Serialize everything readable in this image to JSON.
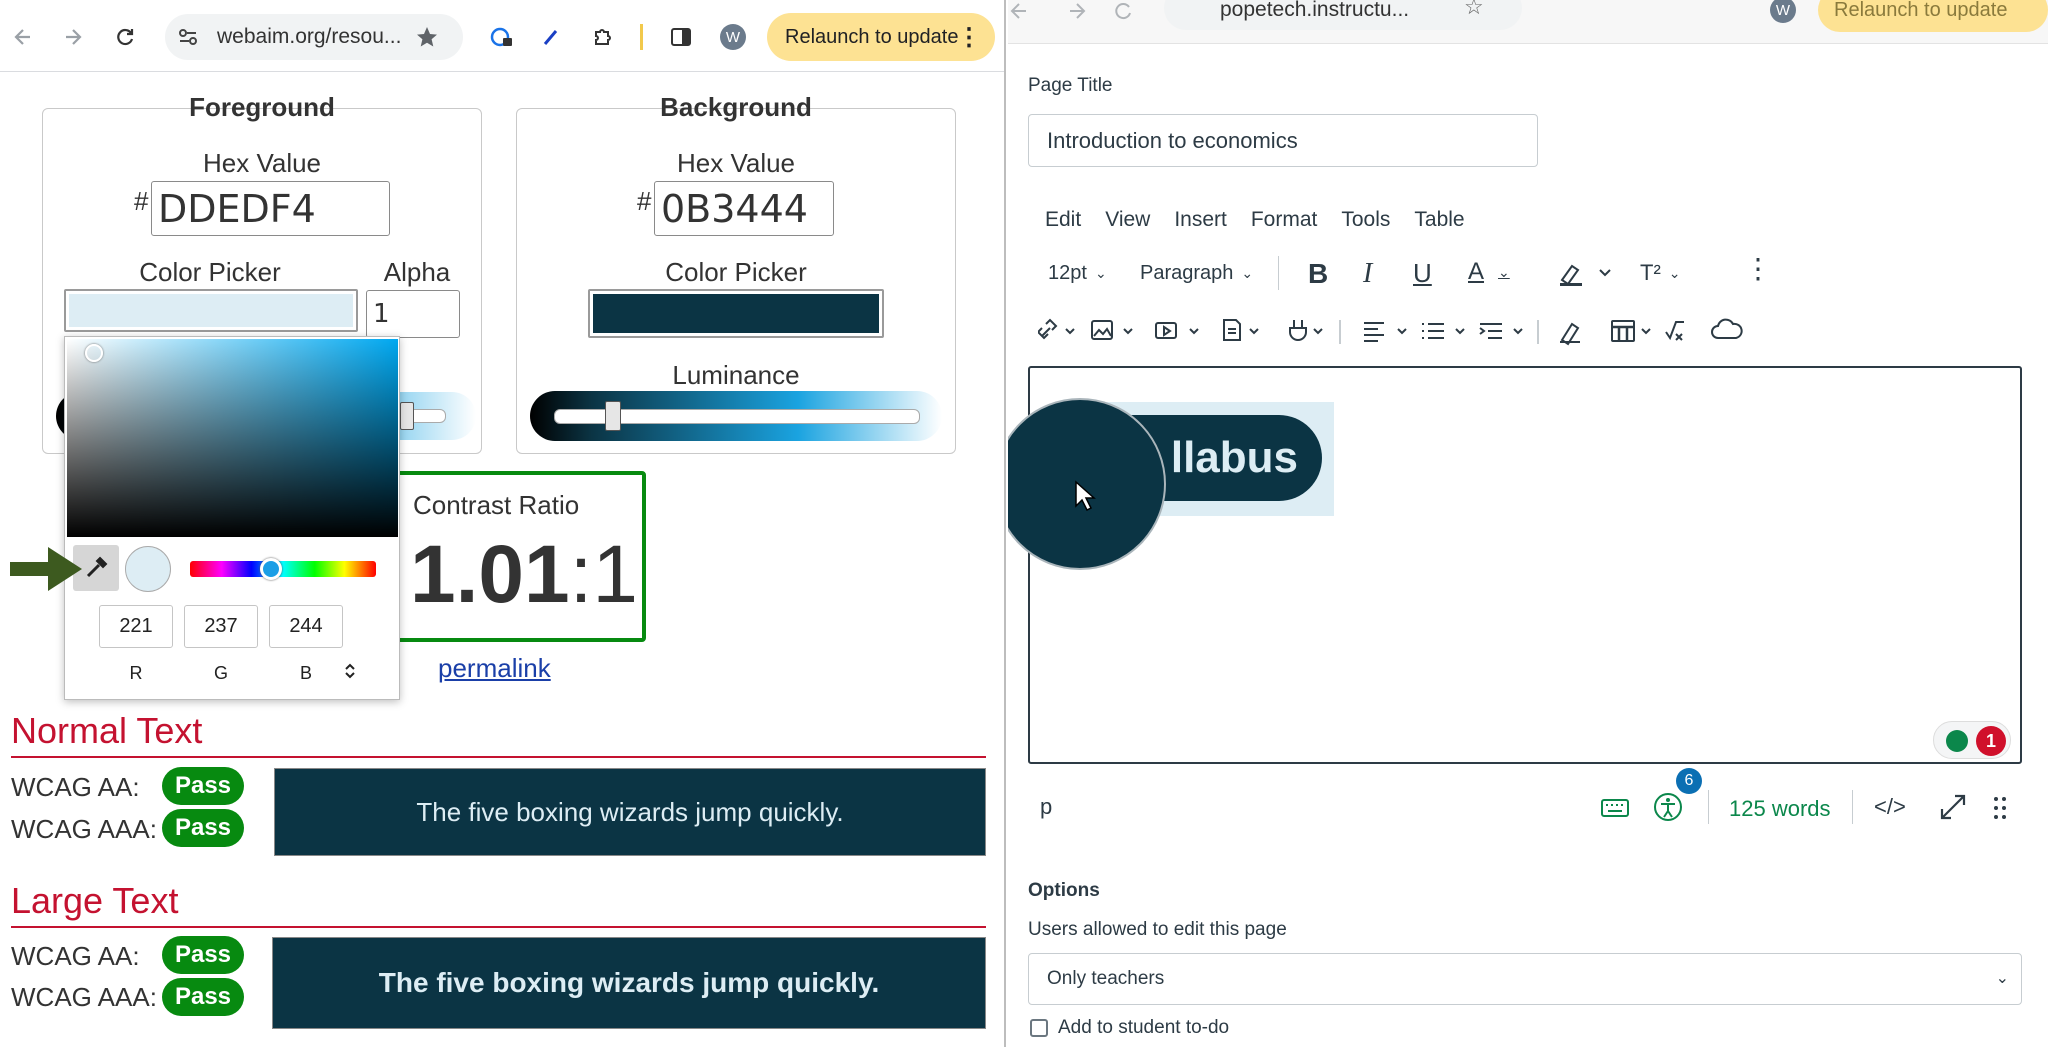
{
  "left_window": {
    "url": "webaim.org/resou...",
    "relaunch_label": "Relaunch to update",
    "avatar_letter": "W",
    "foreground": {
      "title": "Foreground",
      "hex_label": "Hex Value",
      "hash": "#",
      "hex_value": "DDEDF4",
      "picker_label": "Color Picker",
      "alpha_label": "Alpha",
      "alpha_value": "1",
      "color": "#ddedf4"
    },
    "background": {
      "title": "Background",
      "hex_label": "Hex Value",
      "hash": "#",
      "hex_value": "0B3444",
      "picker_label": "Color Picker",
      "luminance_label": "Luminance",
      "color": "#0b3444"
    },
    "color_picker_popup": {
      "r": "221",
      "g": "237",
      "b": "244",
      "r_label": "R",
      "g_label": "G",
      "b_label": "B"
    },
    "contrast": {
      "label": "Contrast Ratio",
      "ratio_main": "1.01",
      "ratio_sep": ":",
      "ratio_tail": "1",
      "permalink": "permalink"
    },
    "normal_text": {
      "heading": "Normal Text",
      "aa_label": "WCAG AA:",
      "aaa_label": "WCAG AAA:",
      "aa_result": "Pass",
      "aaa_result": "Pass",
      "sample": "The five boxing wizards jump quickly."
    },
    "large_text": {
      "heading": "Large Text",
      "aa_label": "WCAG AA:",
      "aaa_label": "WCAG AAA:",
      "aa_result": "Pass",
      "aaa_result": "Pass",
      "sample": "The five boxing wizards jump quickly."
    }
  },
  "right_window": {
    "url": "popetech.instructu...",
    "relaunch_label": "Relaunch to update",
    "avatar_letter": "W",
    "page_title_label": "Page Title",
    "page_title_value": "Introduction to economics",
    "menu": [
      "Edit",
      "View",
      "Insert",
      "Format",
      "Tools",
      "Table"
    ],
    "font_size": "12pt",
    "block_format": "Paragraph",
    "superscript_label": "T²",
    "editor_button_text": "llabus",
    "a11y_issue_count": "1",
    "status_path": "p",
    "a11y_badge_count": "6",
    "word_count": "125 words",
    "html_toggle": "</>",
    "options_label": "Options",
    "edit_perm_label": "Users allowed to edit this page",
    "edit_perm_value": "Only teachers",
    "todo_label": "Add to student to-do"
  },
  "colors": {
    "dark_teal": "#0b3444",
    "light_blue": "#ddedf4",
    "pass_green": "#078a10",
    "heading_red": "#c41230",
    "relaunch_yellow": "#fde293",
    "arrow_green": "#3d5a1f"
  }
}
